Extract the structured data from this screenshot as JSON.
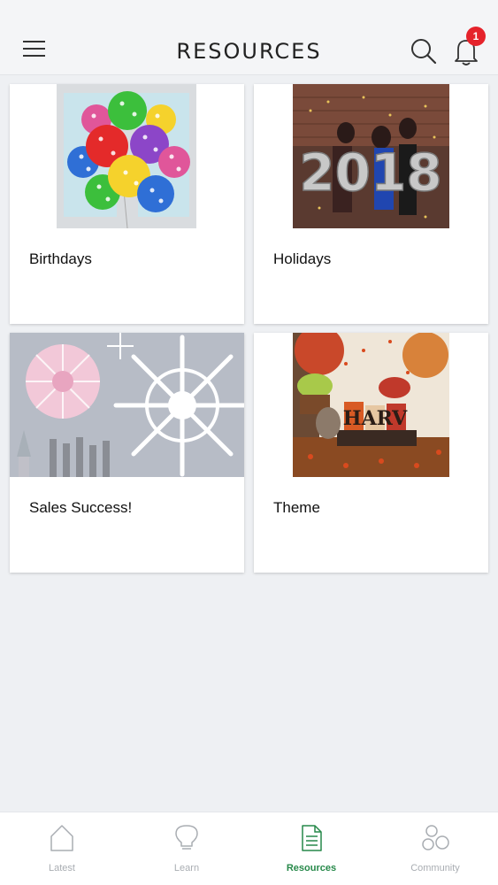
{
  "header": {
    "title": "RESOURCES",
    "notification_count": "1"
  },
  "cards": [
    {
      "label": "Birthdays"
    },
    {
      "label": "Holidays",
      "image_text": "2018"
    },
    {
      "label": "Sales Success!"
    },
    {
      "label": "Theme",
      "image_text": "HARV"
    }
  ],
  "tabs": [
    {
      "label": "Latest",
      "icon": "house-icon"
    },
    {
      "label": "Learn",
      "icon": "lightbulb-icon"
    },
    {
      "label": "Resources",
      "icon": "document-icon",
      "active": true
    },
    {
      "label": "Community",
      "icon": "community-icon"
    }
  ],
  "colors": {
    "accent": "#27894a",
    "badge": "#e5232b",
    "tab_inactive": "#a9adb2"
  }
}
